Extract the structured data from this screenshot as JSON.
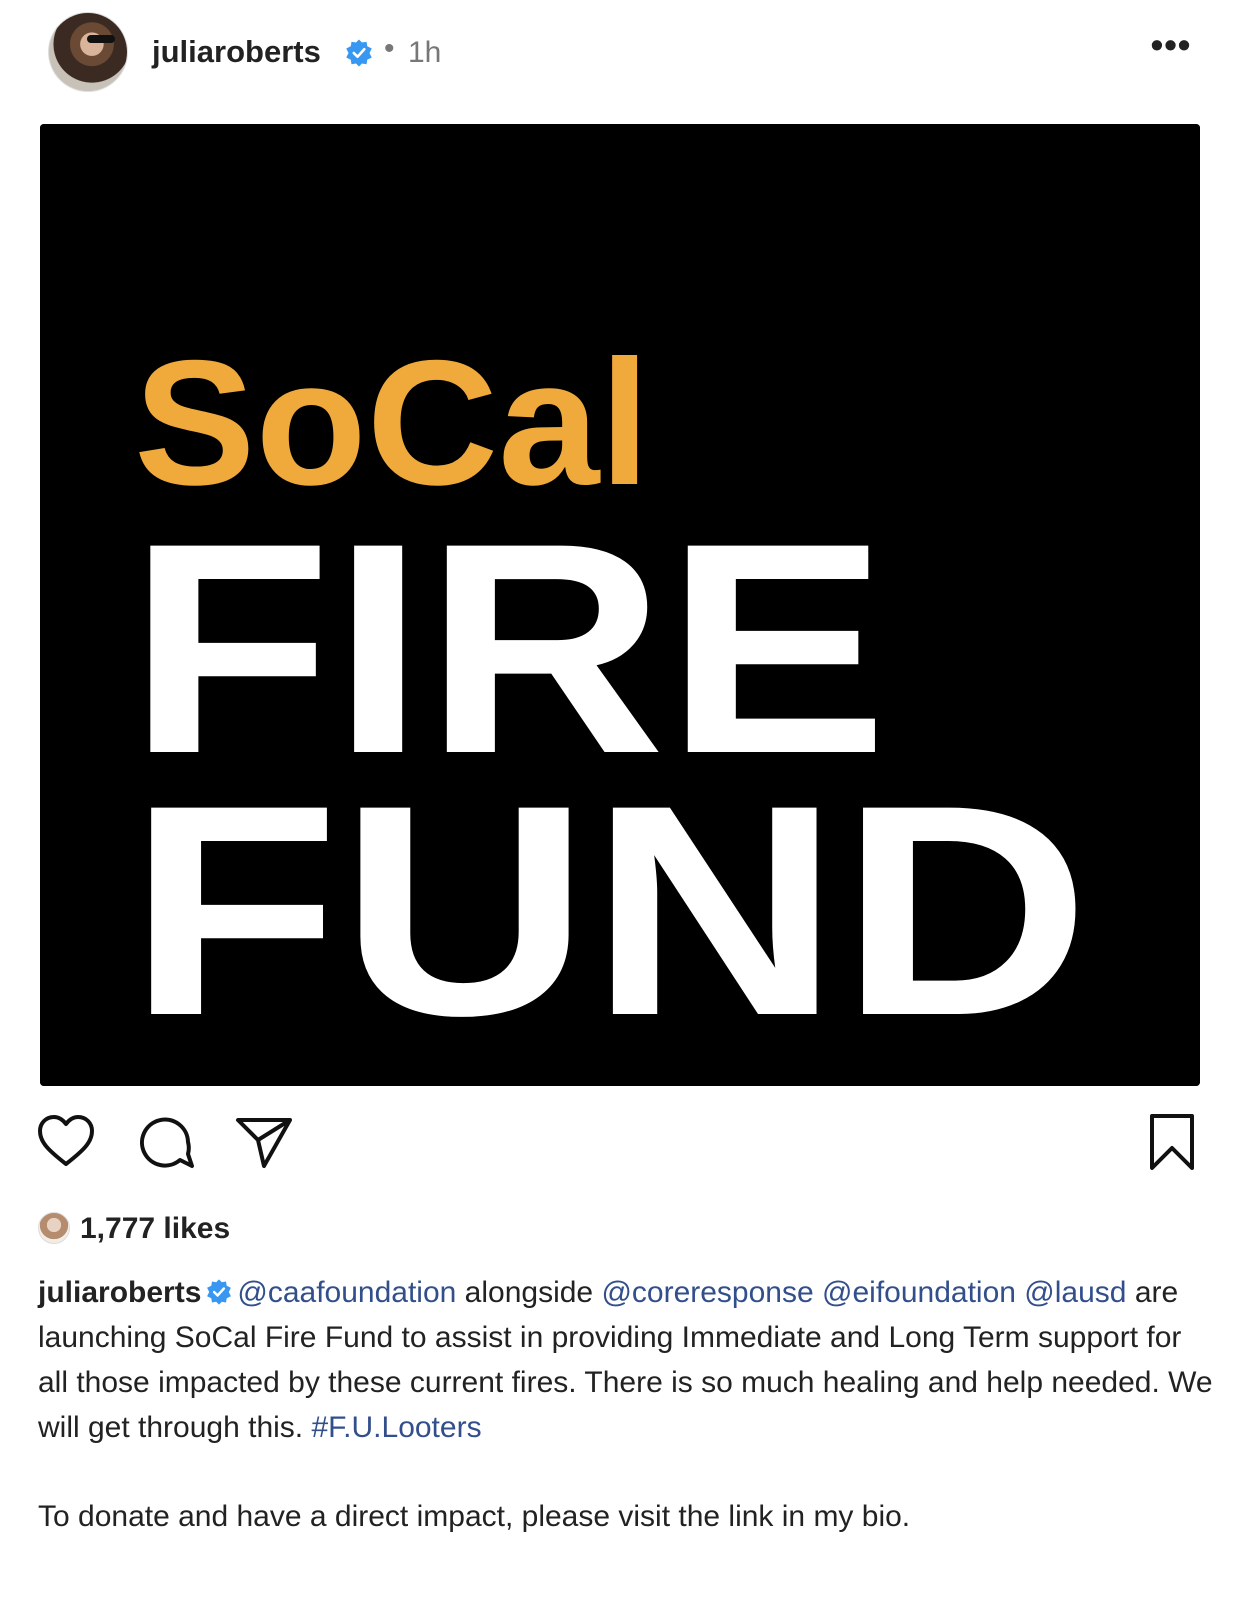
{
  "post": {
    "username": "juliaroberts",
    "time": "1h",
    "dot": "•",
    "more": "•••"
  },
  "image": {
    "line1": "SoCal",
    "line2": "FIRE",
    "line3": "FUND",
    "colors": {
      "accent": "#F0A93B",
      "white": "#FFFFFF",
      "bg": "#000000"
    }
  },
  "actions": {
    "like_icon": "heart-icon",
    "comment_icon": "comment-icon",
    "share_icon": "share-icon",
    "save_icon": "bookmark-icon"
  },
  "likes": {
    "text": "1,777 likes"
  },
  "caption": {
    "username": "juliaroberts",
    "mention1": "@caafoundation",
    "text1": " alongside ",
    "mention2": "@coreresponse",
    "space1": " ",
    "mention3": "@eifoundation",
    "space2": " ",
    "mention4": "@lausd",
    "text2": " are launching SoCal Fire Fund to assist in providing Immediate and Long Term support for all those impacted by these current fires. There is so much healing and help needed. We will get through this. ",
    "hashtag": "#F.U.Looters",
    "paragraph2": "To donate and have a direct impact, please visit the link in my bio."
  },
  "colors": {
    "verified": "#3897F0",
    "mention": "#324F8C",
    "text": "#222222",
    "muted": "#777777"
  }
}
